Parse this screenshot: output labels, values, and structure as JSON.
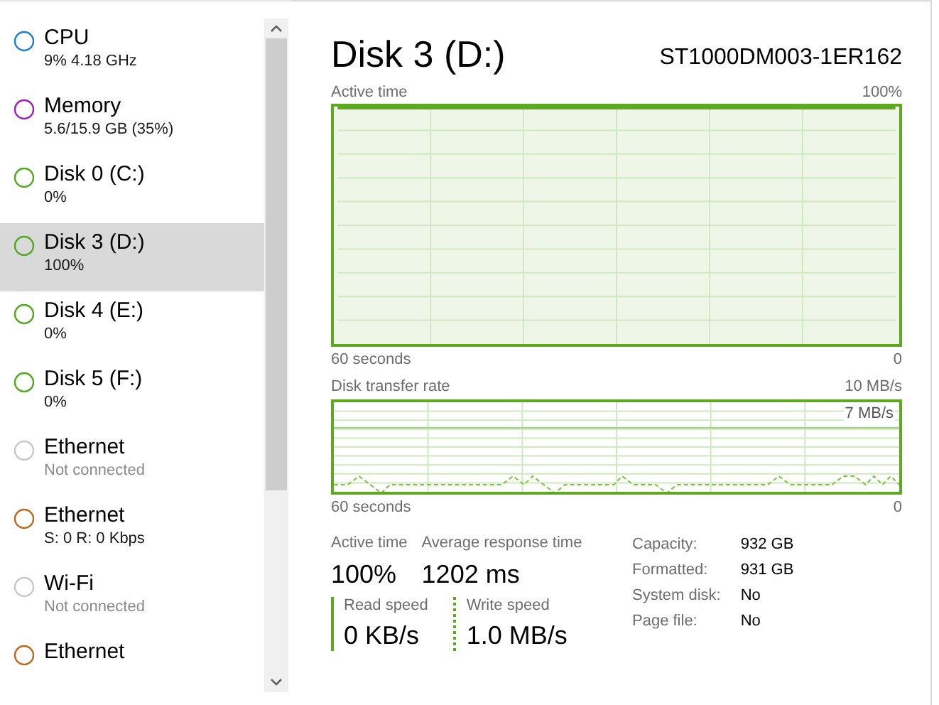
{
  "sidebar": {
    "items": [
      {
        "title": "CPU",
        "subtitle": "9% 4.18 GHz",
        "color": "#1c7ed6",
        "selected": false,
        "muted": false
      },
      {
        "title": "Memory",
        "subtitle": "5.6/15.9 GB (35%)",
        "color": "#9b1fbf",
        "selected": false,
        "muted": false
      },
      {
        "title": "Disk 0 (C:)",
        "subtitle": "0%",
        "color": "#4fa81c",
        "selected": false,
        "muted": false
      },
      {
        "title": "Disk 3 (D:)",
        "subtitle": "100%",
        "color": "#4fa81c",
        "selected": true,
        "muted": false
      },
      {
        "title": "Disk 4 (E:)",
        "subtitle": "0%",
        "color": "#4fa81c",
        "selected": false,
        "muted": false
      },
      {
        "title": "Disk 5 (F:)",
        "subtitle": "0%",
        "color": "#4fa81c",
        "selected": false,
        "muted": false
      },
      {
        "title": "Ethernet",
        "subtitle": "Not connected",
        "color": "#c8c8c8",
        "selected": false,
        "muted": true
      },
      {
        "title": "Ethernet",
        "subtitle": "S: 0 R: 0 Kbps",
        "color": "#c0661c",
        "selected": false,
        "muted": false
      },
      {
        "title": "Wi-Fi",
        "subtitle": "Not connected",
        "color": "#c8c8c8",
        "selected": false,
        "muted": true
      },
      {
        "title": "Ethernet",
        "color": "#c0661c",
        "selected": false
      }
    ]
  },
  "header": {
    "title": "Disk 3 (D:)",
    "model": "ST1000DM003-1ER162"
  },
  "active_time_graph": {
    "label": "Active time",
    "max": "100%",
    "time_span": "60 seconds",
    "min": "0"
  },
  "transfer_graph": {
    "label": "Disk transfer rate",
    "max": "10 MB/s",
    "inner_max": "7 MB/s",
    "time_span": "60 seconds",
    "min": "0"
  },
  "stats": [
    {
      "label": "Active time",
      "value": "100%"
    },
    {
      "label": "Average response time",
      "value": "1202 ms"
    }
  ],
  "speeds": [
    {
      "label": "Read speed",
      "value": "0 KB/s",
      "kind": "solid"
    },
    {
      "label": "Write speed",
      "value": "1.0 MB/s",
      "kind": "dashed"
    }
  ],
  "properties": [
    {
      "label": "Capacity:",
      "value": "932 GB"
    },
    {
      "label": "Formatted:",
      "value": "931 GB"
    },
    {
      "label": "System disk:",
      "value": "No"
    },
    {
      "label": "Page file:",
      "value": "No"
    }
  ]
}
